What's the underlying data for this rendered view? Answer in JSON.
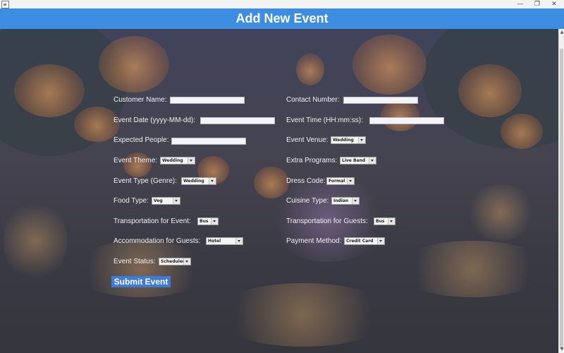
{
  "header": {
    "title": "Add New Event"
  },
  "window": {
    "minimize": "—",
    "restore": "❐",
    "close": "✕"
  },
  "form": {
    "customer_name": {
      "label": "Customer Name:",
      "value": ""
    },
    "contact_number": {
      "label": "Contact Number:",
      "value": ""
    },
    "event_date": {
      "label": "Event Date (yyyy-MM-dd):",
      "value": ""
    },
    "event_time": {
      "label": "Event Time (HH:mm:ss):",
      "value": ""
    },
    "expected_people": {
      "label": "Expected People:",
      "value": ""
    },
    "event_venue": {
      "label": "Event Venue:",
      "value": "Wedding"
    },
    "event_theme": {
      "label": "Event Theme:",
      "value": "Wedding"
    },
    "extra_programs": {
      "label": "Extra Programs:",
      "value": "Live Band"
    },
    "event_type": {
      "label": "Event Type (Genre):",
      "value": "Wedding"
    },
    "dress_code": {
      "label": "Dress Code:",
      "value": "Formal"
    },
    "food_type": {
      "label": "Food Type:",
      "value": "Veg"
    },
    "cuisine_type": {
      "label": "Cuisine Type:",
      "value": "Indian"
    },
    "transport_event": {
      "label": "Transportation for Event:",
      "value": "Bus"
    },
    "transport_guests": {
      "label": "Transportation for Guests:",
      "value": "Bus"
    },
    "accommodation": {
      "label": "Accommodation for Guests:",
      "value": "Hotel"
    },
    "payment_method": {
      "label": "Payment Method:",
      "value": "Credit Card"
    },
    "event_status": {
      "label": "Event Status:",
      "value": "Scheduled"
    },
    "submit_label": "Submit Event"
  }
}
